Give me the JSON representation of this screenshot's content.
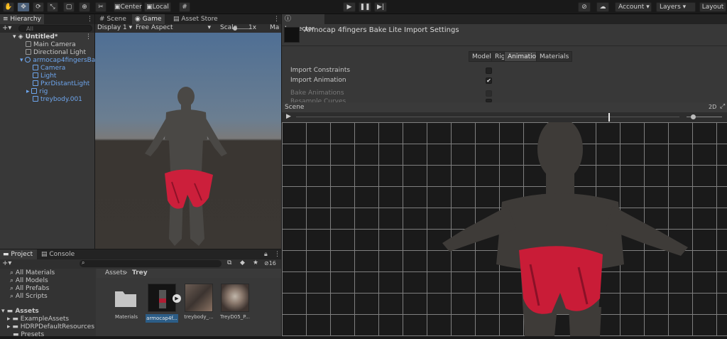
{
  "toolbar": {
    "pivot_label": "Center",
    "space_label": "Local",
    "account_label": "Account",
    "layers_label": "Layers",
    "layout_label": "Layout",
    "colors": {
      "active_tool": "#4b5f78"
    }
  },
  "hierarchy": {
    "tab": "Hierarchy",
    "search_placeholder": "All",
    "items": [
      {
        "label": "Untitled*",
        "icon": "unity-scene-icon"
      },
      {
        "label": "Main Camera",
        "icon": "gameobject-icon"
      },
      {
        "label": "Directional Light",
        "icon": "gameobject-icon"
      },
      {
        "label": "armocap4fingersBake",
        "icon": "prefab-icon"
      },
      {
        "label": "Camera",
        "icon": "prefab-child-icon"
      },
      {
        "label": "Light",
        "icon": "prefab-child-icon"
      },
      {
        "label": "PxrDistantLight",
        "icon": "prefab-child-icon"
      },
      {
        "label": "rig",
        "icon": "prefab-child-icon"
      },
      {
        "label": "treybody.001",
        "icon": "prefab-child-icon"
      }
    ]
  },
  "game": {
    "tabs": [
      "Scene",
      "Game",
      "Asset Store"
    ],
    "display": "Display 1",
    "aspect": "Free Aspect",
    "scale_label": "Scale",
    "scale_value": "1x",
    "maximize_label": "Ma"
  },
  "inspector": {
    "tab": "Inspector",
    "title": "Armocap 4fingers Bake Lite Import Settings",
    "tabs": [
      "Model",
      "Rig",
      "Animation",
      "Materials"
    ],
    "selected_tab": "Animation",
    "props": [
      {
        "label": "Import Constraints",
        "checked": false
      },
      {
        "label": "Import Animation",
        "checked": true
      },
      {
        "label": "Bake Animations",
        "checked": false
      },
      {
        "label": "Resample Curves",
        "checked": true
      }
    ]
  },
  "scene_view": {
    "title": "Scene",
    "mode_2d": "2D"
  },
  "project": {
    "tabs": [
      "Project",
      "Console"
    ],
    "favorites": [
      "All Materials",
      "All Models",
      "All Prefabs",
      "All Scripts"
    ],
    "tree_root": "Assets",
    "tree_items": [
      "ExampleAssets",
      "HDRPDefaultResources",
      "Presets"
    ],
    "breadcrumb": [
      "Assets",
      "Trey"
    ],
    "count_badge": "16",
    "assets": [
      {
        "label": "Materials",
        "type": "folder"
      },
      {
        "label": "armocap4f...",
        "type": "model"
      },
      {
        "label": "treybody_...",
        "type": "texture"
      },
      {
        "label": "TreyD05_P...",
        "type": "texture"
      }
    ]
  }
}
